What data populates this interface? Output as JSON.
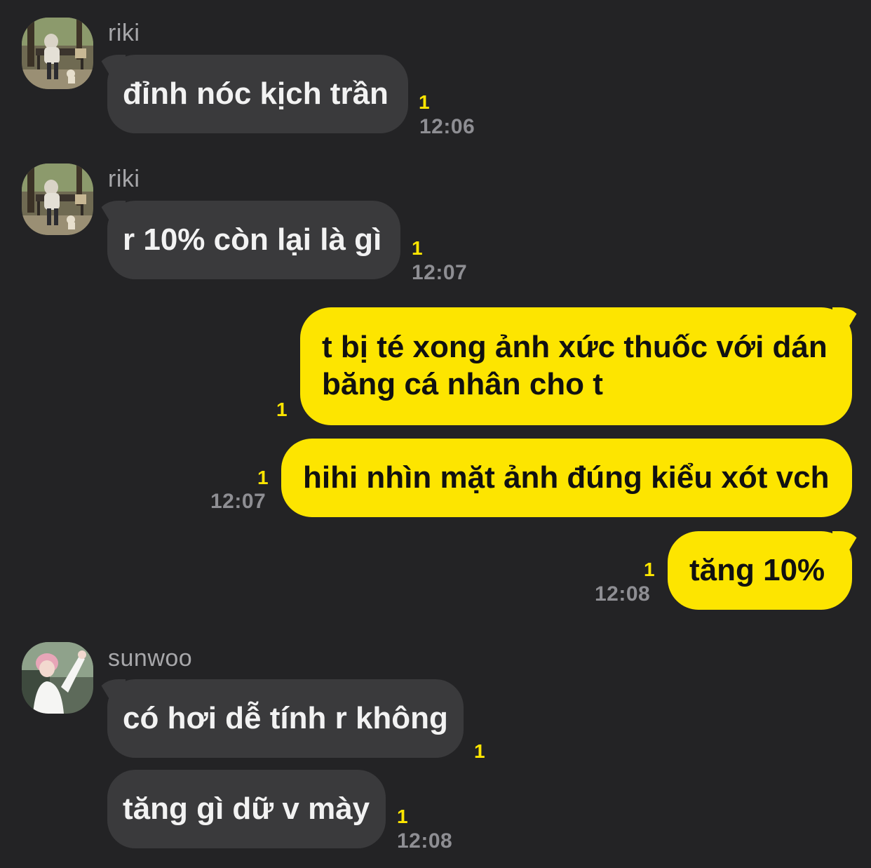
{
  "messages": [
    {
      "sender": "riki",
      "text": "đỉnh nóc kịch trần",
      "unread": "1",
      "time": "12:06"
    },
    {
      "sender": "riki",
      "text": "r 10% còn lại là gì",
      "unread": "1",
      "time": "12:07"
    },
    {
      "text_line1": "t bị té xong ảnh xức thuốc với dán",
      "text_line2": "băng cá nhân cho t",
      "unread": "1"
    },
    {
      "text": "hihi nhìn mặt ảnh đúng kiểu xót vch",
      "unread": "1",
      "time": "12:07"
    },
    {
      "text": "tăng 10%",
      "unread": "1",
      "time": "12:08"
    },
    {
      "sender": "sunwoo",
      "text": "có hơi dễ tính r không",
      "unread": "1"
    },
    {
      "text": "tăng gì dữ v mày",
      "unread": "1",
      "time": "12:08"
    }
  ],
  "colors": {
    "background": "#232325",
    "incoming_bubble": "#3a3a3c",
    "outgoing_bubble": "#fde500",
    "unread": "#fde500",
    "timestamp": "#8e8e93"
  },
  "icons": {
    "riki_avatar": "person-on-park-bench-photo",
    "sunwoo_avatar": "pink-haired-person-photo"
  }
}
